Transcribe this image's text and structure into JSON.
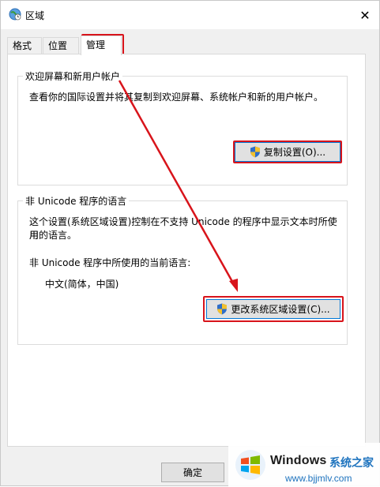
{
  "window": {
    "title": "区域",
    "close_glyph": "✕"
  },
  "tabs": [
    {
      "label": "格式"
    },
    {
      "label": "位置"
    },
    {
      "label": "管理"
    }
  ],
  "welcome_group": {
    "label": "欢迎屏幕和新用户帐户",
    "description": "查看你的国际设置并将其复制到欢迎屏幕、系统帐户和新的用户帐户。",
    "copy_button": "复制设置(O)..."
  },
  "nonunicode_group": {
    "label": "非 Unicode 程序的语言",
    "description_line1": "这个设置(系统区域设置)控制在不支持 Unicode 的程序中显示文本时所使用",
    "description_line2": "用的语言。",
    "current_label": "非 Unicode 程序中所使用的当前语言:",
    "current_value": "中文(简体，中国)",
    "change_button": "更改系统区域设置(C)..."
  },
  "footer": {
    "ok_button": "确定"
  },
  "watermark": {
    "brand": "Windows",
    "cn": "系统之家",
    "url": "www.bjjmlv.com"
  },
  "colors": {
    "annotation_red": "#d8141b",
    "focus_blue": "#0078d7",
    "watermark_blue": "#1e73be"
  },
  "icons": {
    "app": "globe-clock-icon",
    "shield": "uac-shield-icon",
    "arrow": "annotation-arrow"
  }
}
